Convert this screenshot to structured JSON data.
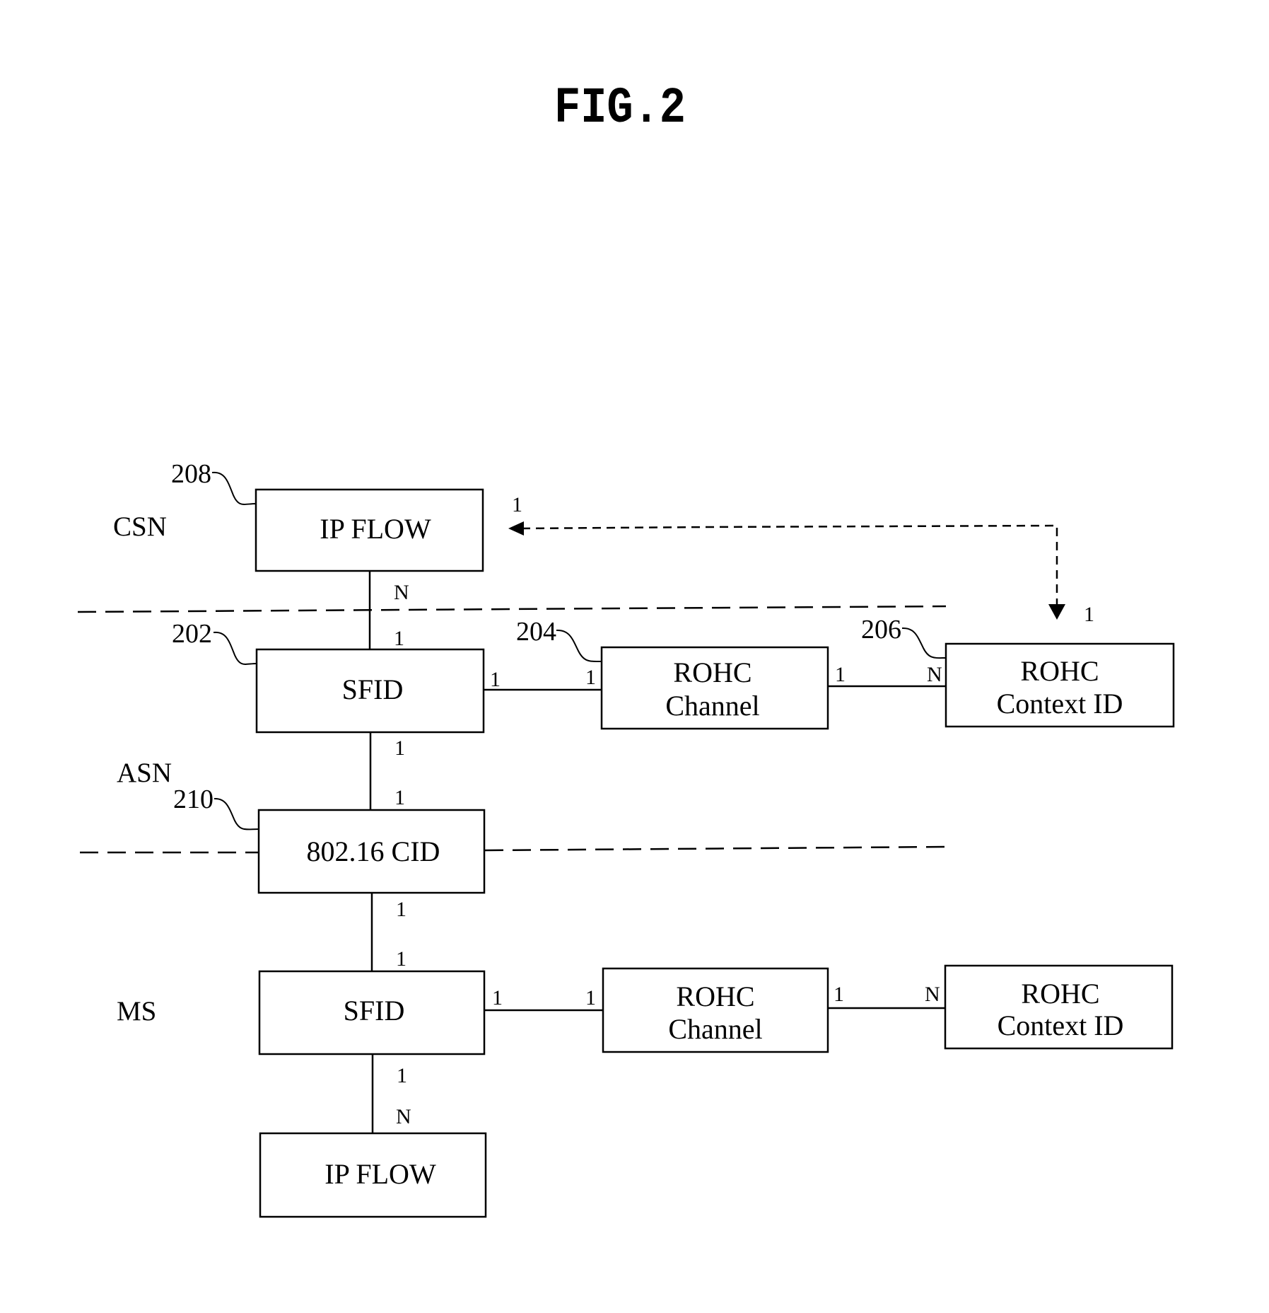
{
  "figure": {
    "title": "FIG.2"
  },
  "zones": {
    "csn": "CSN",
    "asn": "ASN",
    "ms": "MS"
  },
  "reference_numerals": {
    "ip_flow_csn": "208",
    "sfid_asn": "202",
    "rohc_channel_asn": "204",
    "rohc_context_asn": "206",
    "cid": "210"
  },
  "boxes": {
    "ip_flow_csn": [
      "IP FLOW"
    ],
    "sfid_asn": [
      "SFID"
    ],
    "rohc_channel_asn": [
      "ROHC",
      "Channel"
    ],
    "rohc_context_asn": [
      "ROHC",
      "Context ID"
    ],
    "cid": [
      "802.16 CID"
    ],
    "sfid_ms": [
      "SFID"
    ],
    "rohc_channel_ms": [
      "ROHC",
      "Channel"
    ],
    "rohc_context_ms": [
      "ROHC",
      "Context ID"
    ],
    "ip_flow_ms": [
      "IP FLOW"
    ]
  },
  "cardinalities": {
    "ipflow_csn_to_sfid_top": "N",
    "ipflow_csn_to_sfid_bottom": "1",
    "sfid_asn_to_channel_left": "1",
    "sfid_asn_to_channel_right": "1",
    "channel_asn_to_context_left": "1",
    "channel_asn_to_context_right": "N",
    "context_to_ipflow_arrow_left": "1",
    "context_to_ipflow_arrow_down": "1",
    "sfid_asn_to_cid_top": "1",
    "sfid_asn_to_cid_bottom": "1",
    "cid_to_sfid_ms_top": "1",
    "cid_to_sfid_ms_bottom": "1",
    "sfid_ms_to_channel_left": "1",
    "sfid_ms_to_channel_right": "1",
    "channel_ms_to_context_left": "1",
    "channel_ms_to_context_right": "N",
    "sfid_ms_to_ipflow_top": "1",
    "sfid_ms_to_ipflow_bottom": "N"
  }
}
